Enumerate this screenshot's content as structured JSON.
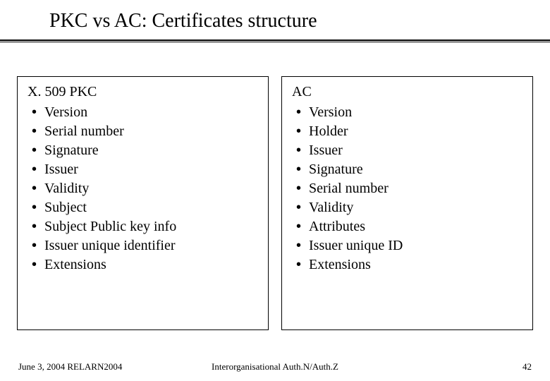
{
  "title": "PKC vs AC: Certificates structure",
  "left": {
    "heading": "X. 509 PKC",
    "items": [
      "Version",
      "Serial number",
      "Signature",
      "Issuer",
      "Validity",
      "Subject",
      "Subject Public key info",
      "Issuer unique identifier",
      "Extensions"
    ]
  },
  "right": {
    "heading": "AC",
    "items": [
      "Version",
      "Holder",
      "Issuer",
      "Signature",
      "Serial number",
      "Validity",
      "Attributes",
      "Issuer unique ID",
      "Extensions"
    ]
  },
  "footer": {
    "left": "June 3, 2004 RELARN2004",
    "center": "Interorganisational Auth.N/Auth.Z",
    "right": "42"
  }
}
